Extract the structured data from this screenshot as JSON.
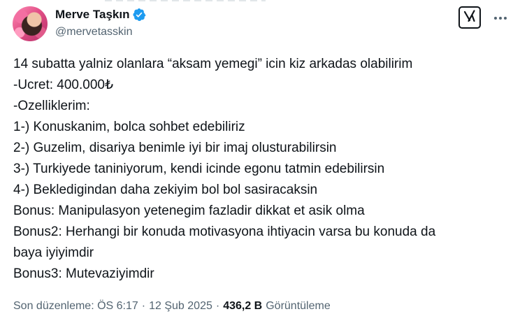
{
  "author": {
    "display_name": "Merve Taşkın",
    "handle": "@mervetasskin",
    "verified": true,
    "verified_color": "#1d9bf0",
    "avatar_icon": "profile-photo"
  },
  "actions": {
    "grok_icon": "grok-icon",
    "more_icon": "more-dots-icon"
  },
  "tweet": {
    "lines": [
      "14 subatta yalniz olanlara “aksam yemegi” icin kiz arkadas olabilirim",
      "-Ucret: 400.000₺",
      "-Ozelliklerim:",
      "1-) Konuskanim, bolca sohbet edebiliriz",
      "2-) Guzelim, disariya benimle iyi bir imaj olusturabilirsin",
      "3-) Turkiyede taniniyorum, kendi icinde egonu tatmin edebilirsin",
      "4-) Bekledigindan daha zekiyim bol bol sasiracaksin",
      "Bonus: Manipulasyon yetenegim fazladir dikkat et asik olma",
      "Bonus2: Herhangi bir konuda motivasyona ihtiyacin varsa bu konuda da",
      "baya iyiyimdir",
      "Bonus3: Mutevaziyimdir"
    ]
  },
  "meta": {
    "edited_time": "Son düzenleme: ÖS 6:17",
    "separator": "·",
    "date": "12 Şub 2025",
    "views_count": "436,2 B",
    "views_label": "Görüntüleme"
  },
  "colors": {
    "text_primary": "#0f1419",
    "text_secondary": "#536471",
    "accent": "#1d9bf0"
  }
}
